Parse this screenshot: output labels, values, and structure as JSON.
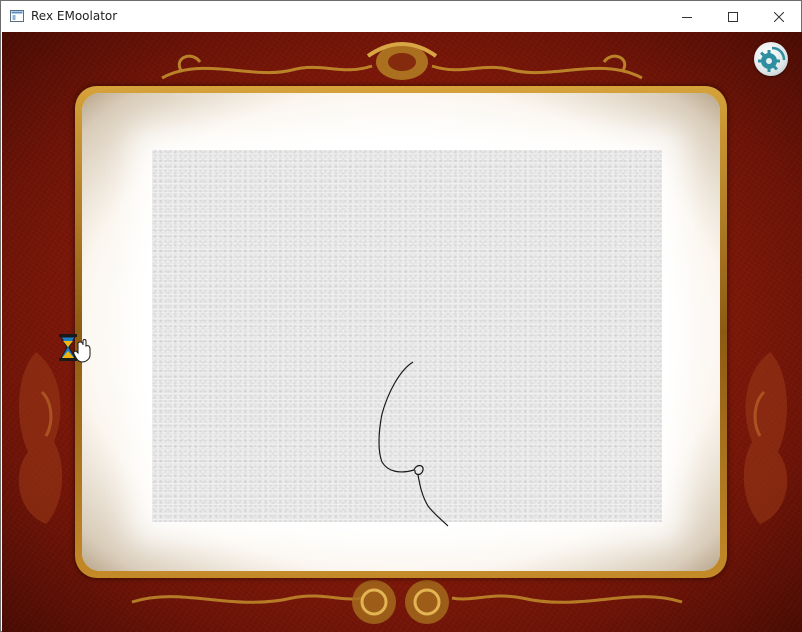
{
  "window": {
    "title": "Rex EMoolator",
    "controls": {
      "minimize_icon": "minimize-icon",
      "maximize_icon": "maximize-icon",
      "close_icon": "close-icon"
    }
  },
  "app": {
    "settings_icon": "gear-icon",
    "cursor_icon": "hourglass-hand-icon"
  },
  "colors": {
    "background_red": "#8c1c0c",
    "frame_gold": "#c48a28",
    "canvas": "#f1f1f1",
    "ink": "#1a1a1a",
    "gear_button": "#dfe6e7",
    "gear_accent": "#2e8fa0"
  }
}
